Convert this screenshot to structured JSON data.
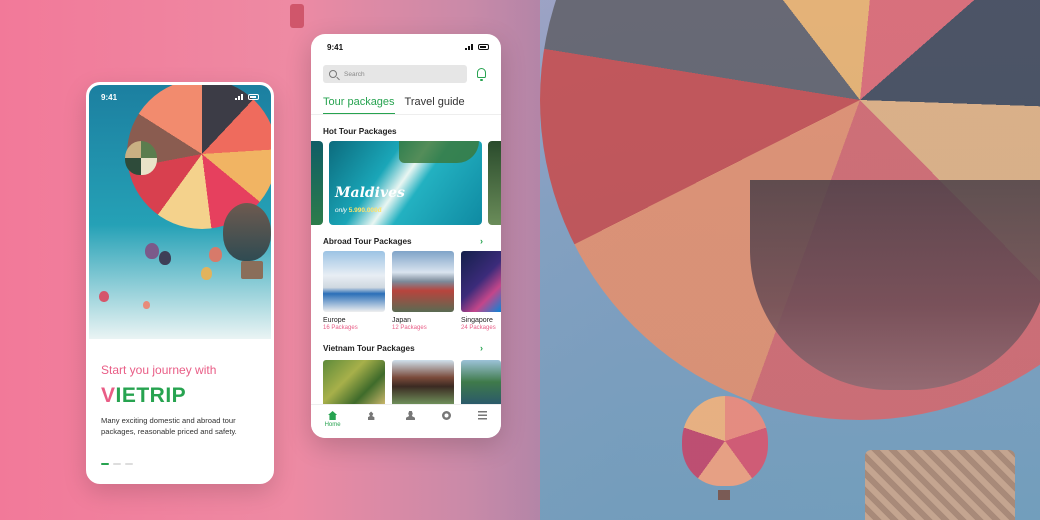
{
  "onboarding": {
    "status_time": "9:41",
    "tagline": "Start you journey with",
    "logo_accent": "V",
    "logo_rest": "IETRIP",
    "description": "Many exciting domestic and abroad tour packages, reasonable priced and safety."
  },
  "home": {
    "status_time": "9:41",
    "search_placeholder": "Search",
    "tabs": [
      {
        "label": "Tour packages",
        "active": true
      },
      {
        "label": "Travel guide",
        "active": false
      }
    ],
    "hot": {
      "title": "Hot Tour Packages",
      "card_title": "Maldives",
      "card_price_prefix": "only",
      "card_price": "5.990.000đ"
    },
    "abroad": {
      "title": "Abroad Tour Packages",
      "items": [
        {
          "name": "Europe",
          "count": "16 Packages"
        },
        {
          "name": "Japan",
          "count": "12 Packages"
        },
        {
          "name": "Singapore",
          "count": "24 Packages"
        }
      ]
    },
    "vietnam": {
      "title": "Vietnam Tour Packages"
    },
    "nav": {
      "home_label": "Home"
    },
    "colors": {
      "accent": "#27a350",
      "pink": "#e95d86"
    }
  }
}
